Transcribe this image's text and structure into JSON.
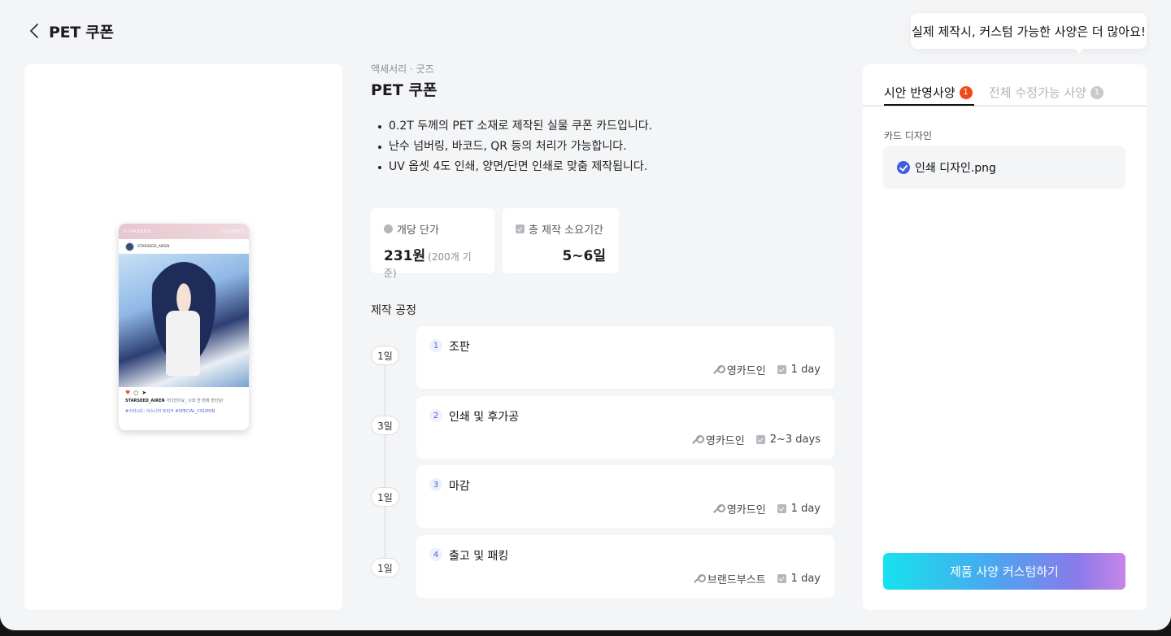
{
  "header": {
    "title": "PET 쿠폰"
  },
  "tooltip": {
    "text": "실제 제작시, 커스텀 가능한 사양은 더 많아요!"
  },
  "preview": {
    "card": {
      "brand": "STARSEED",
      "corner": "COSMOS",
      "username": "STARSEED_AIREN",
      "caption_user": "STARSEED_AIREN",
      "caption_text": "가디언이요_ 나와 한 번에 한인님!",
      "tags": "#스타시드: 아스니아 트리거 #SPECIAL_COUPON"
    }
  },
  "product": {
    "category": "액세서리 · 굿즈",
    "title": "PET 쿠폰",
    "bullets": [
      "0.2T 두께의 PET 소재로 제작된 실물 쿠폰 카드입니다.",
      "난수 넘버링, 바코드, QR 등의 처리가 가능합니다.",
      "UV 옵셋 4도 인쇄, 양면/단면 인쇄로 맞춤 제작됩니다."
    ],
    "stats": {
      "unit_price_label": "개당 단가",
      "unit_price_value": "231원",
      "unit_price_sub": "(200개 기준)",
      "lead_time_label": "총 제작 소요기간",
      "lead_time_value": "5~6일"
    }
  },
  "process": {
    "title": "제작 공정",
    "steps": [
      {
        "num": "1",
        "name": "조판",
        "day": "1일",
        "vendor": "영카드인",
        "duration": "1 day"
      },
      {
        "num": "2",
        "name": "인쇄 및 후가공",
        "day": "3일",
        "vendor": "영카드인",
        "duration": "2~3 days"
      },
      {
        "num": "3",
        "name": "마감",
        "day": "1일",
        "vendor": "영카드인",
        "duration": "1 day"
      },
      {
        "num": "4",
        "name": "출고 및 패킹",
        "day": "1일",
        "vendor": "브랜드부스트",
        "duration": "1 day"
      }
    ]
  },
  "panel": {
    "tabs": [
      {
        "label": "시안 반영사양",
        "badge": "1"
      },
      {
        "label": "전체 수정가능 사양",
        "badge": "1"
      }
    ],
    "section_label": "카드 디자인",
    "file_name": "인쇄 디자인.png",
    "cta_label": "제품 사양 커스텀하기"
  },
  "colors": {
    "accent_badge": "#f04a1a",
    "check_blue": "#3f5fe0",
    "cta_gradient_start": "#15e3ee",
    "cta_gradient_end": "#c785e7"
  }
}
